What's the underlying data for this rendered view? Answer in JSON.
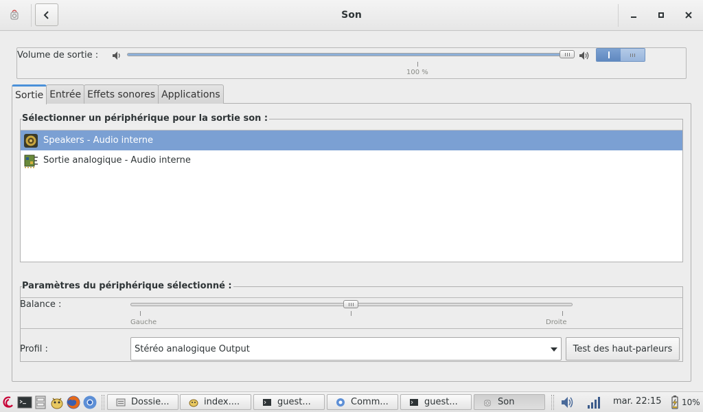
{
  "window": {
    "title": "Son"
  },
  "output_volume": {
    "label": "Volume de sortie :",
    "value_percent": 100,
    "mark_label": "100 %"
  },
  "tabs": [
    {
      "label": "Sortie",
      "active": true
    },
    {
      "label": "Entrée",
      "active": false
    },
    {
      "label": "Effets sonores",
      "active": false
    },
    {
      "label": "Applications",
      "active": false
    }
  ],
  "device_section": {
    "title": "Sélectionner un périphérique pour la sortie son :",
    "devices": [
      {
        "label": "Speakers - Audio interne",
        "selected": true,
        "icon": "speaker-icon"
      },
      {
        "label": "Sortie analogique - Audio interne",
        "selected": false,
        "icon": "sound-card-icon"
      }
    ]
  },
  "params_section": {
    "title": "Paramètres du périphérique sélectionné :",
    "balance": {
      "label": "Balance :",
      "value": 0.5,
      "left_label": "Gauche",
      "right_label": "Droite"
    },
    "profile": {
      "label": "Profil :",
      "value": "Stéréo analogique Output"
    },
    "test_button": "Test des haut-parleurs"
  },
  "taskbar": {
    "launchers": [
      "debian-menu-icon",
      "terminal-icon",
      "file-cabinet-icon",
      "pidgin-icon",
      "firefox-icon",
      "chromium-icon"
    ],
    "tasks": [
      {
        "label": "Dossie...",
        "icon": "folder-icon",
        "active": false
      },
      {
        "label": "index....",
        "icon": "pidgin-icon",
        "active": false
      },
      {
        "label": "guest...",
        "icon": "terminal-icon",
        "active": false
      },
      {
        "label": "Comm...",
        "icon": "chromium-icon",
        "active": false
      },
      {
        "label": "guest...",
        "icon": "terminal-icon",
        "active": false
      },
      {
        "label": "Son",
        "icon": "sound-icon",
        "active": true
      }
    ],
    "clock": "mar. 22:15",
    "battery": "10%"
  },
  "colors": {
    "accent": "#4a90d9",
    "selection": "#7ba0d3",
    "slider_fill": "#8cafd8"
  }
}
